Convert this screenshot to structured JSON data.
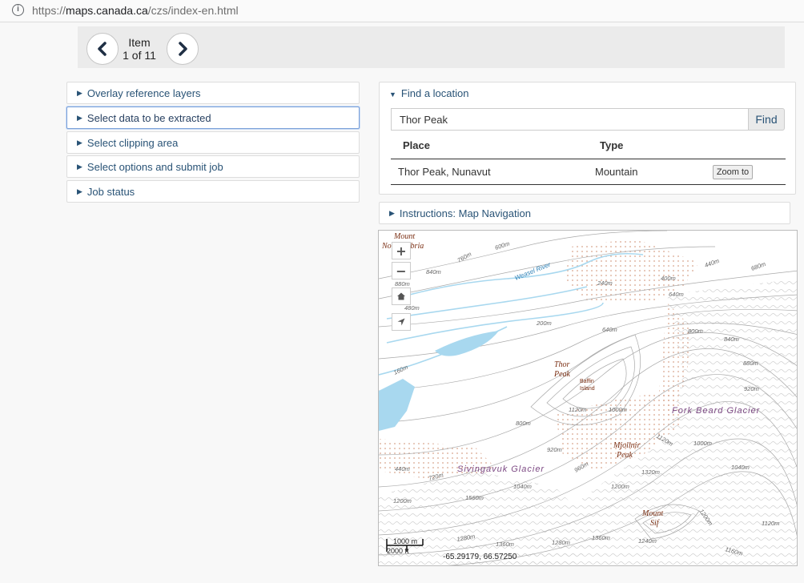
{
  "browser": {
    "url_prefix": "https://",
    "url_main": "maps.canada.ca",
    "url_suffix": "/czs/index-en.html",
    "info_icon": "info-icon"
  },
  "pager": {
    "line1": "Item",
    "line2": "1 of 11",
    "prev_icon": "chevron-left-icon",
    "next_icon": "chevron-right-icon"
  },
  "accordion": [
    {
      "label": "Overlay reference layers"
    },
    {
      "label": "Select data to be extracted"
    },
    {
      "label": "Select clipping area"
    },
    {
      "label": "Select options and submit job"
    },
    {
      "label": "Job status"
    }
  ],
  "find": {
    "heading": "Find a location",
    "input_value": "Thor Peak",
    "button": "Find",
    "columns": [
      "Place",
      "Type"
    ],
    "rows": [
      {
        "place": "Thor Peak, Nunavut",
        "type": "Mountain",
        "action": "Zoom to"
      }
    ]
  },
  "instructions": {
    "label": "Instructions: Map Navigation"
  },
  "map": {
    "labels": {
      "mount_north": "Mount",
      "mount_north2": "Northumbria",
      "weasel": "Weasel River",
      "thor1": "Thor",
      "thor2": "Peak",
      "baffin1": "Baffin",
      "baffin2": "Island",
      "fork": "Fork Beard Glacier",
      "mjoll1": "Mjollnir",
      "mjoll2": "Peak",
      "siving": "Sivingavuk Glacier",
      "sif1": "Mount",
      "sif2": "Sif"
    },
    "contours": [
      "760m",
      "600m",
      "840m",
      "880m",
      "480m",
      "200m",
      "160m",
      "240m",
      "400m",
      "640m",
      "440m",
      "680m",
      "640m",
      "800m",
      "840m",
      "880m",
      "920m",
      "1000m",
      "1120m",
      "800m",
      "920m",
      "960m",
      "1120m",
      "1000m",
      "1040m",
      "1320m",
      "1200m",
      "720m",
      "440m",
      "1040m",
      "1560m",
      "1200m",
      "1280m",
      "1360m",
      "1280m",
      "1360m",
      "1240m",
      "1160m",
      "1120m",
      "1200m"
    ],
    "controls": {
      "zoom_in": "+",
      "zoom_out": "−",
      "home_icon": "home-icon",
      "locate_icon": "navigate-icon"
    },
    "scale_top": "1000 m",
    "scale_bottom": "2000 ft",
    "coordinates": "-65.29179, 66.57250"
  },
  "colors": {
    "link": "#295376",
    "water": "#a8d8ef",
    "contour": "#999999",
    "place": "#7a2e12",
    "glacier": "#7d4a84"
  }
}
